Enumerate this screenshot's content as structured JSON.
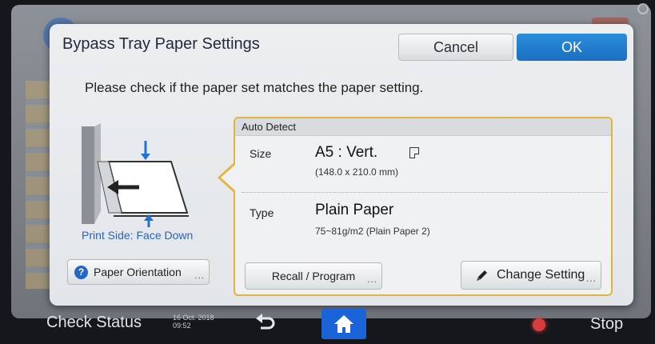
{
  "dialog": {
    "title": "Bypass Tray Paper Settings",
    "cancel_label": "Cancel",
    "ok_label": "OK",
    "instruction": "Please check if the paper set matches the paper setting."
  },
  "illustration": {
    "print_side": "Print Side: Face Down",
    "orientation_label": "Paper Orientation",
    "more_indicator": "..."
  },
  "panel": {
    "header": "Auto Detect",
    "size_label": "Size",
    "size_value": "A5 : Vert.",
    "size_detail": "(148.0 x 210.0 mm)",
    "type_label": "Type",
    "type_value": "Plain Paper",
    "type_detail": "75~81g/m2 (Plain Paper 2)",
    "recall_label": "Recall / Program",
    "change_label": "Change Setting",
    "more_indicator": "..."
  },
  "bottom_bar": {
    "check_status": "Check Status",
    "date": "16 Oct. 2018",
    "time": "09:52",
    "stop_label": "Stop"
  },
  "colors": {
    "accent": "#1a6fc0",
    "panel_border": "#e4b33d",
    "home_button": "#1a63d8",
    "stop_indicator": "#d83c3c"
  },
  "icons": [
    "back-circle-icon",
    "help-icon",
    "page-portrait-icon",
    "pencil-icon",
    "back-arrow-icon",
    "home-icon",
    "stop-indicator-icon"
  ]
}
